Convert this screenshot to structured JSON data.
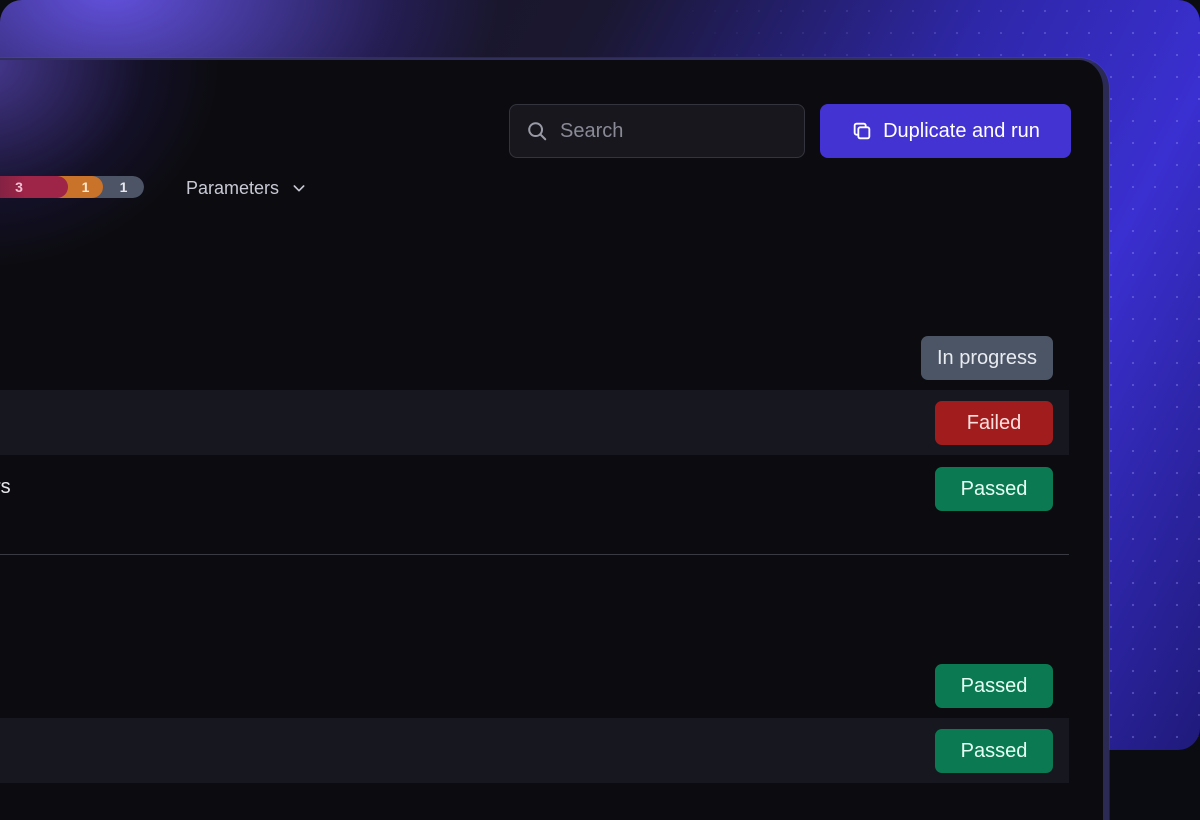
{
  "search": {
    "placeholder": "Search"
  },
  "actions": {
    "duplicate_label": "Duplicate and run"
  },
  "counters": [
    {
      "value": "3",
      "color": "#9e2448"
    },
    {
      "value": "1",
      "color": "#c9722a"
    },
    {
      "value": "1",
      "color": "#4c5466"
    }
  ],
  "filters": {
    "parameters_label": "Parameters"
  },
  "rows": [
    {
      "label": "",
      "status": "In progress"
    },
    {
      "label": "",
      "status": "Failed"
    },
    {
      "label": "rs",
      "status": "Passed"
    },
    {
      "label": "",
      "status": "Passed"
    },
    {
      "label": "",
      "status": "Passed"
    }
  ],
  "colors": {
    "accent": "#4433d3",
    "passed": "#0b7a52",
    "failed": "#a11d1d",
    "in_progress": "#4b5565"
  },
  "icons": {
    "search": "search-icon",
    "duplicate": "copy-icon",
    "parameters": "chevron-down-icon"
  }
}
